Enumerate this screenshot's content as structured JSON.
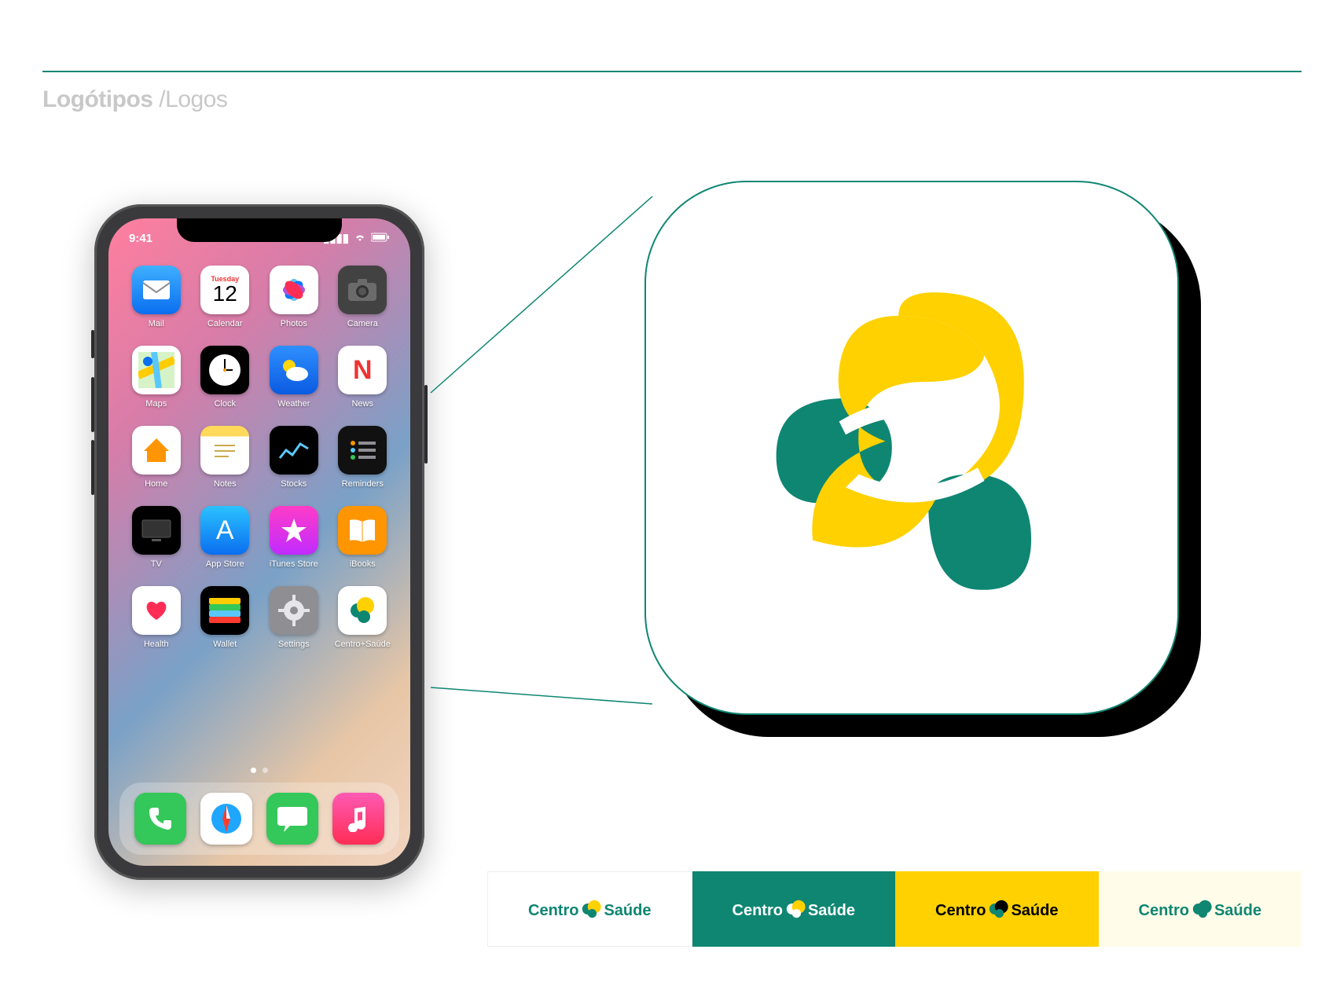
{
  "header": {
    "title_bold": "Logótipos ",
    "title_light": "/Logos"
  },
  "brand": {
    "name_a": "Centro",
    "name_b": "Saúde",
    "colors": {
      "teal": "#0e8672",
      "yellow": "#ffd100",
      "black": "#000000",
      "cream": "#fffce9"
    }
  },
  "phone": {
    "status": {
      "time": "9:41",
      "signal": "▮▮▮▮",
      "wifi": "wifi-icon",
      "battery": "battery-icon"
    },
    "calendar": {
      "weekday": "Tuesday",
      "day": "12"
    },
    "apps_rows": [
      [
        {
          "label": "Mail",
          "icon": "envelope",
          "cls": "c-mail"
        },
        {
          "label": "Calendar",
          "icon": "calendar",
          "cls": "c-cal"
        },
        {
          "label": "Photos",
          "icon": "flower",
          "cls": "c-photos"
        },
        {
          "label": "Camera",
          "icon": "camera",
          "cls": "c-cam"
        }
      ],
      [
        {
          "label": "Maps",
          "icon": "map",
          "cls": "c-maps"
        },
        {
          "label": "Clock",
          "icon": "clock",
          "cls": "c-clock"
        },
        {
          "label": "Weather",
          "icon": "weather",
          "cls": "c-weather"
        },
        {
          "label": "News",
          "icon": "N",
          "cls": "c-news"
        }
      ],
      [
        {
          "label": "Home",
          "icon": "home",
          "cls": "c-home"
        },
        {
          "label": "Notes",
          "icon": "notes",
          "cls": "c-notes"
        },
        {
          "label": "Stocks",
          "icon": "stocks",
          "cls": "c-stocks"
        },
        {
          "label": "Reminders",
          "icon": "list",
          "cls": "c-rem"
        }
      ],
      [
        {
          "label": "TV",
          "icon": "tv",
          "cls": "c-tv"
        },
        {
          "label": "App Store",
          "icon": "A",
          "cls": "c-appstore"
        },
        {
          "label": "iTunes Store",
          "icon": "star",
          "cls": "c-itunes"
        },
        {
          "label": "iBooks",
          "icon": "book",
          "cls": "c-ibooks"
        }
      ],
      [
        {
          "label": "Health",
          "icon": "heart",
          "cls": "c-health"
        },
        {
          "label": "Wallet",
          "icon": "wallet",
          "cls": "c-wallet"
        },
        {
          "label": "Settings",
          "icon": "gear",
          "cls": "c-settings"
        },
        {
          "label": "Centro+Saúde",
          "icon": "cs",
          "cls": "c-cs"
        }
      ]
    ],
    "dock": [
      {
        "label": "Phone",
        "icon": "phone",
        "cls": "c-phone"
      },
      {
        "label": "Safari",
        "icon": "compass",
        "cls": "c-safari"
      },
      {
        "label": "Messages",
        "icon": "bubble",
        "cls": "c-msg"
      },
      {
        "label": "Music",
        "icon": "note",
        "cls": "c-music"
      }
    ]
  },
  "strip": {
    "variants": [
      {
        "bg": "white",
        "word_color": "#0e8672",
        "mark_primary": "#ffd100",
        "mark_secondary": "#0e8672"
      },
      {
        "bg": "teal",
        "word_color": "#ffffff",
        "mark_primary": "#ffd100",
        "mark_secondary": "#ffffff"
      },
      {
        "bg": "yellow",
        "word_color": "#000000",
        "mark_primary": "#000000",
        "mark_secondary": "#0e8672"
      },
      {
        "bg": "cream",
        "word_color": "#0e8672",
        "mark_primary": "#0e8672",
        "mark_secondary": "#0e8672"
      }
    ]
  }
}
